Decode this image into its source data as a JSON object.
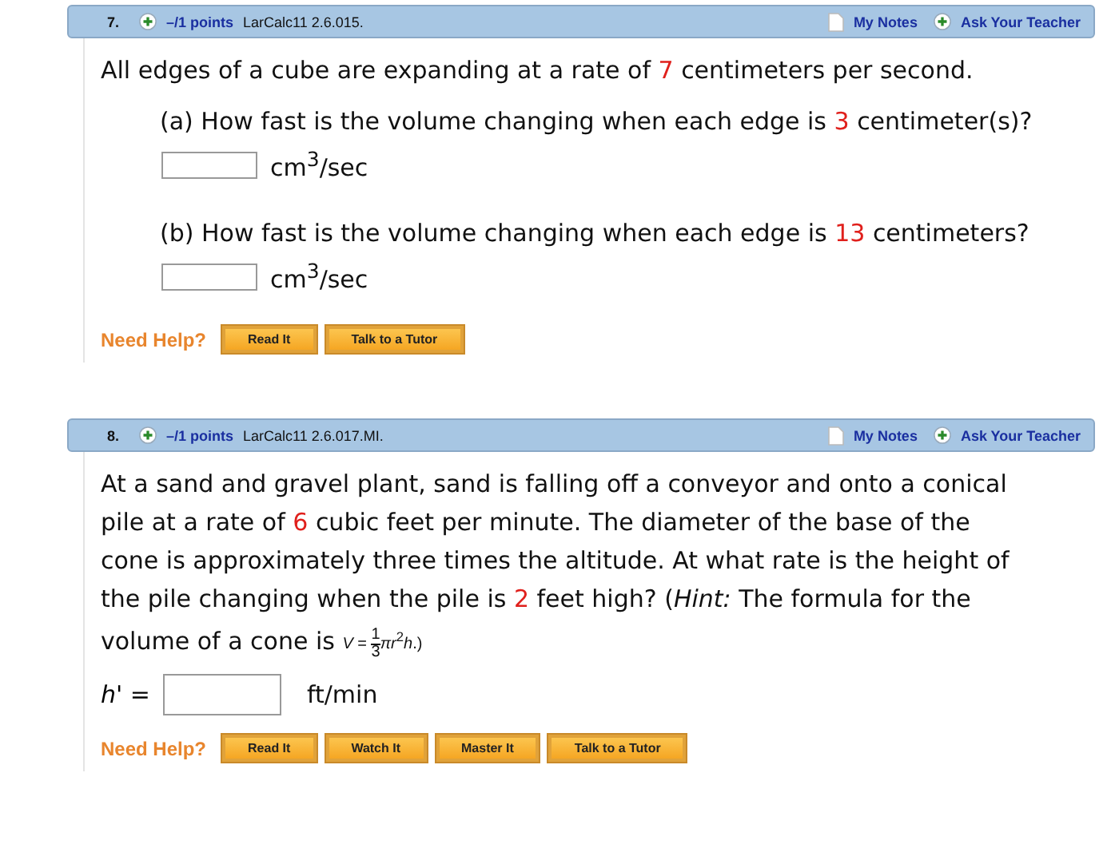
{
  "questions": [
    {
      "number": "7.",
      "points": "–/1 points",
      "source": "LarCalc11 2.6.015.",
      "notes_label": "My Notes",
      "teacher_label": "Ask Your Teacher",
      "items": [
        {
          "kind": "text",
          "segments": [
            {
              "kind": "plain",
              "text": "All edges of a cube are expanding at a rate of "
            },
            {
              "kind": "red",
              "text": "7"
            },
            {
              "kind": "plain",
              "text": " centimeters per second."
            }
          ]
        },
        {
          "kind": "part",
          "segments": [
            {
              "kind": "plain",
              "text": "(a) How fast is the volume changing when each edge is "
            },
            {
              "kind": "red",
              "text": "3"
            },
            {
              "kind": "plain",
              "text": " centimeter(s)?"
            }
          ],
          "unit": "cm$^{3}$/sec"
        },
        {
          "kind": "part",
          "segments": [
            {
              "kind": "plain",
              "text": "(b) How fast is the volume changing when each edge is "
            },
            {
              "kind": "red",
              "text": "13"
            },
            {
              "kind": "plain",
              "text": " centimeters?"
            }
          ],
          "unit": "cm$^{3}$/sec"
        }
      ],
      "help_label": "Need Help?",
      "help_buttons": [
        "Read It",
        "Talk to a Tutor"
      ]
    },
    {
      "number": "8.",
      "points": "–/1 points",
      "source": "LarCalc11 2.6.017.MI.",
      "notes_label": "My Notes",
      "teacher_label": "Ask Your Teacher",
      "items": [
        {
          "kind": "text",
          "segments": [
            {
              "kind": "plain",
              "text": "At a sand and gravel plant, sand is falling off a conveyor and onto a conical pile at a rate of "
            },
            {
              "kind": "red",
              "text": "6"
            },
            {
              "kind": "plain",
              "text": " cubic feet per minute. The diameter of the base of the cone is approximately three times the altitude. At what rate is the height of the pile changing when the pile is "
            },
            {
              "kind": "red",
              "text": "2"
            },
            {
              "kind": "plain",
              "text": " feet high? (*Hint:* The formula for the volume of a cone is "
            },
            {
              "kind": "formula",
              "lhs": "*V* =",
              "num": "1",
              "den": "3",
              "rest": "*πr*$^{2}$*h*.)"
            }
          ]
        },
        {
          "kind": "answer",
          "label": "*h*' =",
          "unit": "ft/min"
        }
      ],
      "help_label": "Need Help?",
      "help_buttons": [
        "Read It",
        "Watch It",
        "Master It",
        "Talk to a Tutor"
      ]
    }
  ]
}
